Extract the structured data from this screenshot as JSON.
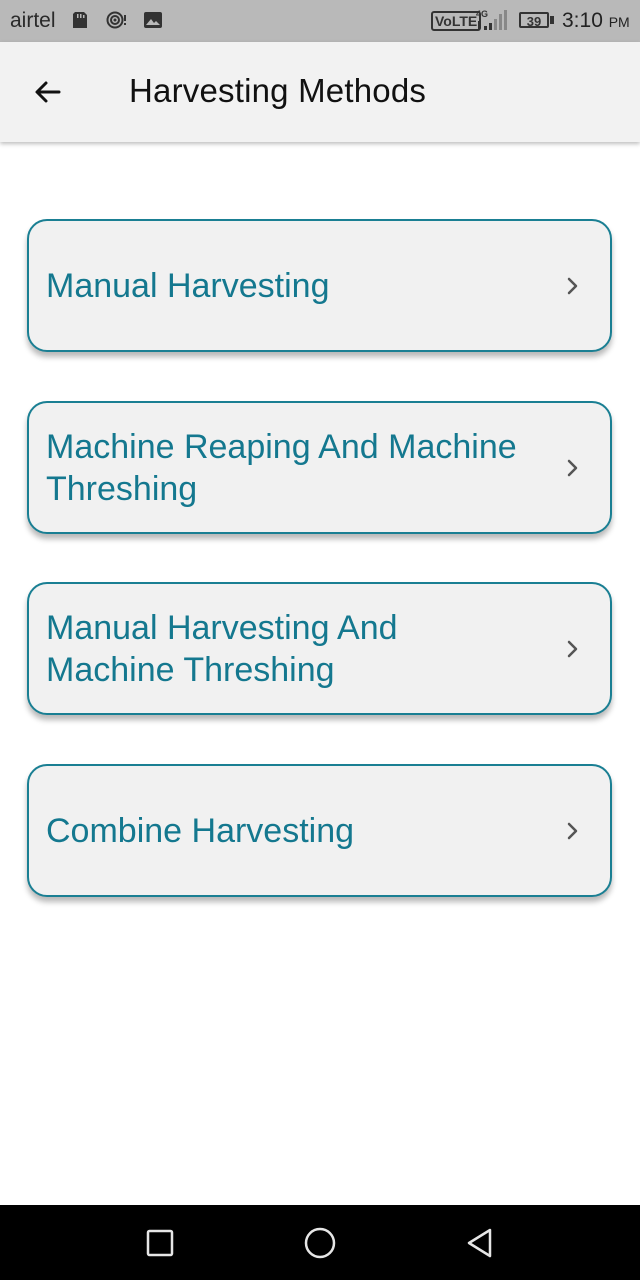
{
  "status_bar": {
    "carrier": "airtel",
    "network_badge": "VoLTE",
    "network_type": "4G",
    "battery": "39",
    "time": "3:10",
    "ampm": "PM",
    "icons": [
      "sd-card-icon",
      "hotspot-icon",
      "gallery-icon",
      "signal-icon",
      "battery-icon"
    ]
  },
  "app_bar": {
    "back_icon": "arrow-left-icon",
    "title": "Harvesting Methods"
  },
  "methods": [
    {
      "label": "Manual Harvesting",
      "icon": "chevron-right-icon"
    },
    {
      "label": "Machine Reaping And Machine Threshing",
      "icon": "chevron-right-icon"
    },
    {
      "label": "Manual Harvesting And Machine Threshing",
      "icon": "chevron-right-icon"
    },
    {
      "label": "Combine Harvesting",
      "icon": "chevron-right-icon"
    }
  ],
  "nav_bar": {
    "buttons": [
      "recents-square-icon",
      "home-circle-icon",
      "back-triangle-icon"
    ]
  },
  "colors": {
    "accent": "#14788f",
    "card_border": "#1a7f93",
    "card_bg": "#f1f1f1",
    "app_bar_bg": "#f2f2f2",
    "status_bar_bg": "#b9b9b9",
    "nav_bar_bg": "#000000"
  }
}
